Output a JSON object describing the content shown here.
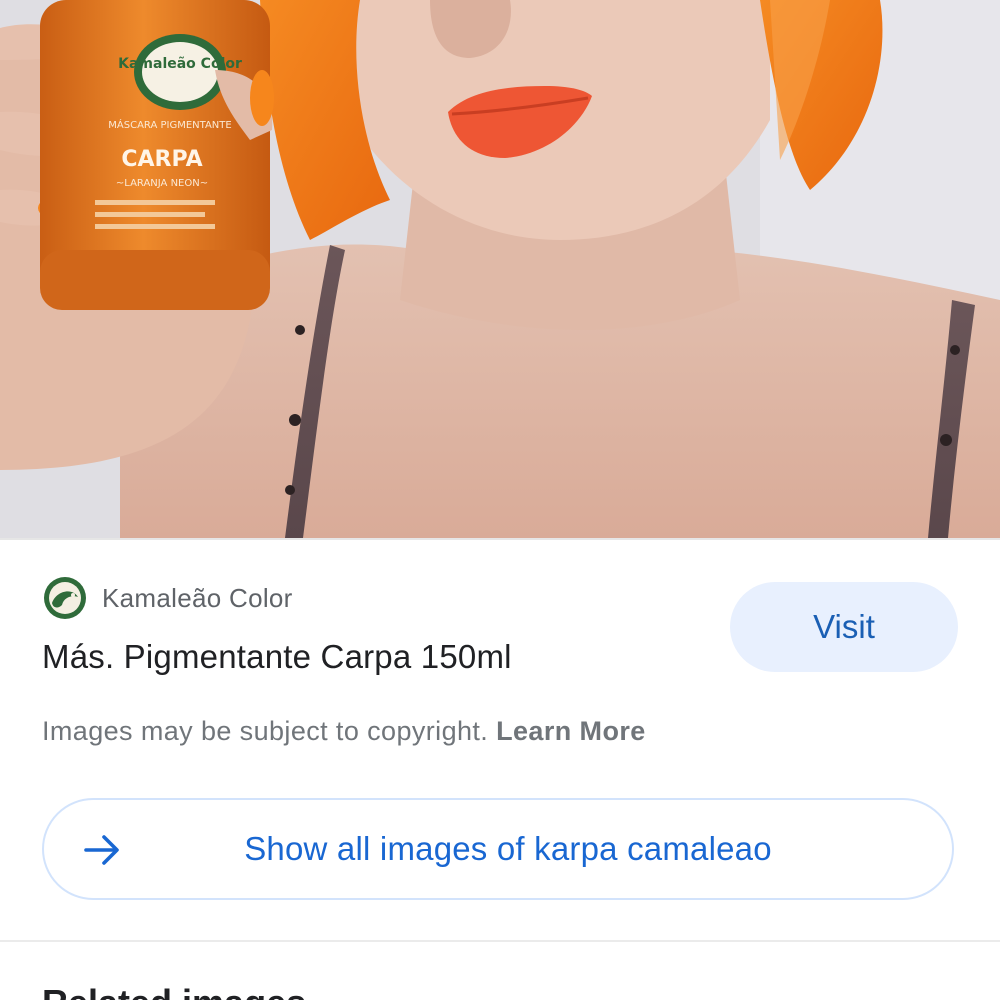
{
  "source": {
    "name": "Kamaleão Color",
    "logo_text": "Kamaleão Color"
  },
  "product": {
    "title": "Más. Pigmentante Carpa 150ml",
    "label_brand": "Kamaleão Color",
    "label_type": "MÁSCARA PIGMENTANTE",
    "label_name": "CARPA",
    "label_subname": "~LARANJA NEON~"
  },
  "actions": {
    "visit_label": "Visit",
    "show_all_label": "Show all images of karpa camaleao"
  },
  "notice": {
    "text": "Images may be subject to copyright.",
    "link": "Learn More"
  },
  "related": {
    "heading": "Related images"
  },
  "colors": {
    "accent": "#1967d2",
    "visit_bg": "#e8f0fe",
    "hair": "#f07a1c",
    "lips": "#ef5a38",
    "bottle": "#e2771f",
    "logo_green": "#2f6b3a"
  },
  "icons": {
    "arrow": "arrow-right-icon"
  }
}
